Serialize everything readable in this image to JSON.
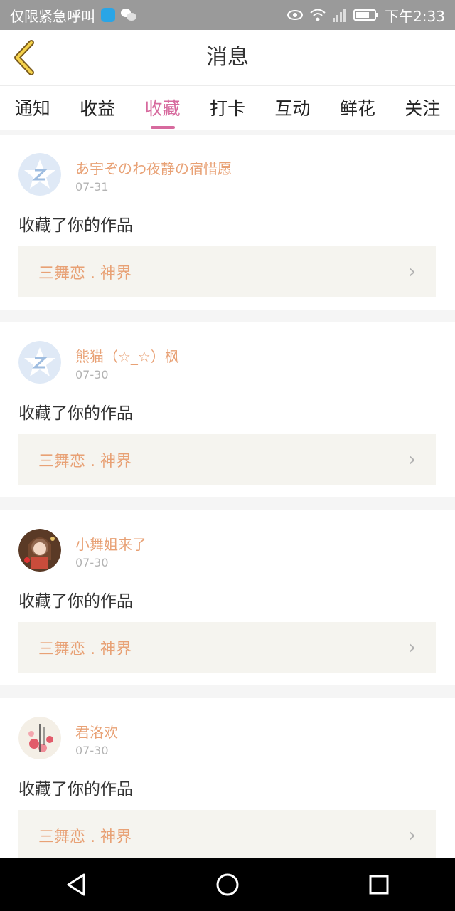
{
  "status_bar": {
    "left_text": "仅限紧急呼叫",
    "time": "下午2:33",
    "icons": [
      "shield-icon",
      "wechat-icon",
      "eye-icon",
      "wifi-icon",
      "signal-icon",
      "battery-icon"
    ]
  },
  "header": {
    "title": "消息",
    "back_icon": "chevron-left-icon"
  },
  "tabs": [
    {
      "label": "通知"
    },
    {
      "label": "收益"
    },
    {
      "label": "收藏",
      "active": true
    },
    {
      "label": "打卡"
    },
    {
      "label": "互动"
    },
    {
      "label": "鲜花"
    },
    {
      "label": "关注"
    }
  ],
  "items": [
    {
      "user": "あ宇ぞのわ夜静の宿惜愿",
      "date": "07-31",
      "message": "收藏了你的作品",
      "work": "三舞恋 . 神界",
      "avatar": "default"
    },
    {
      "user": "熊猫（☆_☆）枫",
      "date": "07-30",
      "message": "收藏了你的作品",
      "work": "三舞恋 . 神界",
      "avatar": "default"
    },
    {
      "user": "小舞姐来了",
      "date": "07-30",
      "message": "收藏了你的作品",
      "work": "三舞恋 . 神界",
      "avatar": "photo"
    },
    {
      "user": "君洛欢",
      "date": "07-30",
      "message": "收藏了你的作品",
      "work": "三舞恋 . 神界",
      "avatar": "flower"
    }
  ],
  "nav": [
    "back-triangle-icon",
    "home-circle-icon",
    "recent-square-icon"
  ],
  "colors": {
    "accent": "#d76a9e",
    "name": "#e8a175",
    "link_bg": "#f5f4ef"
  }
}
